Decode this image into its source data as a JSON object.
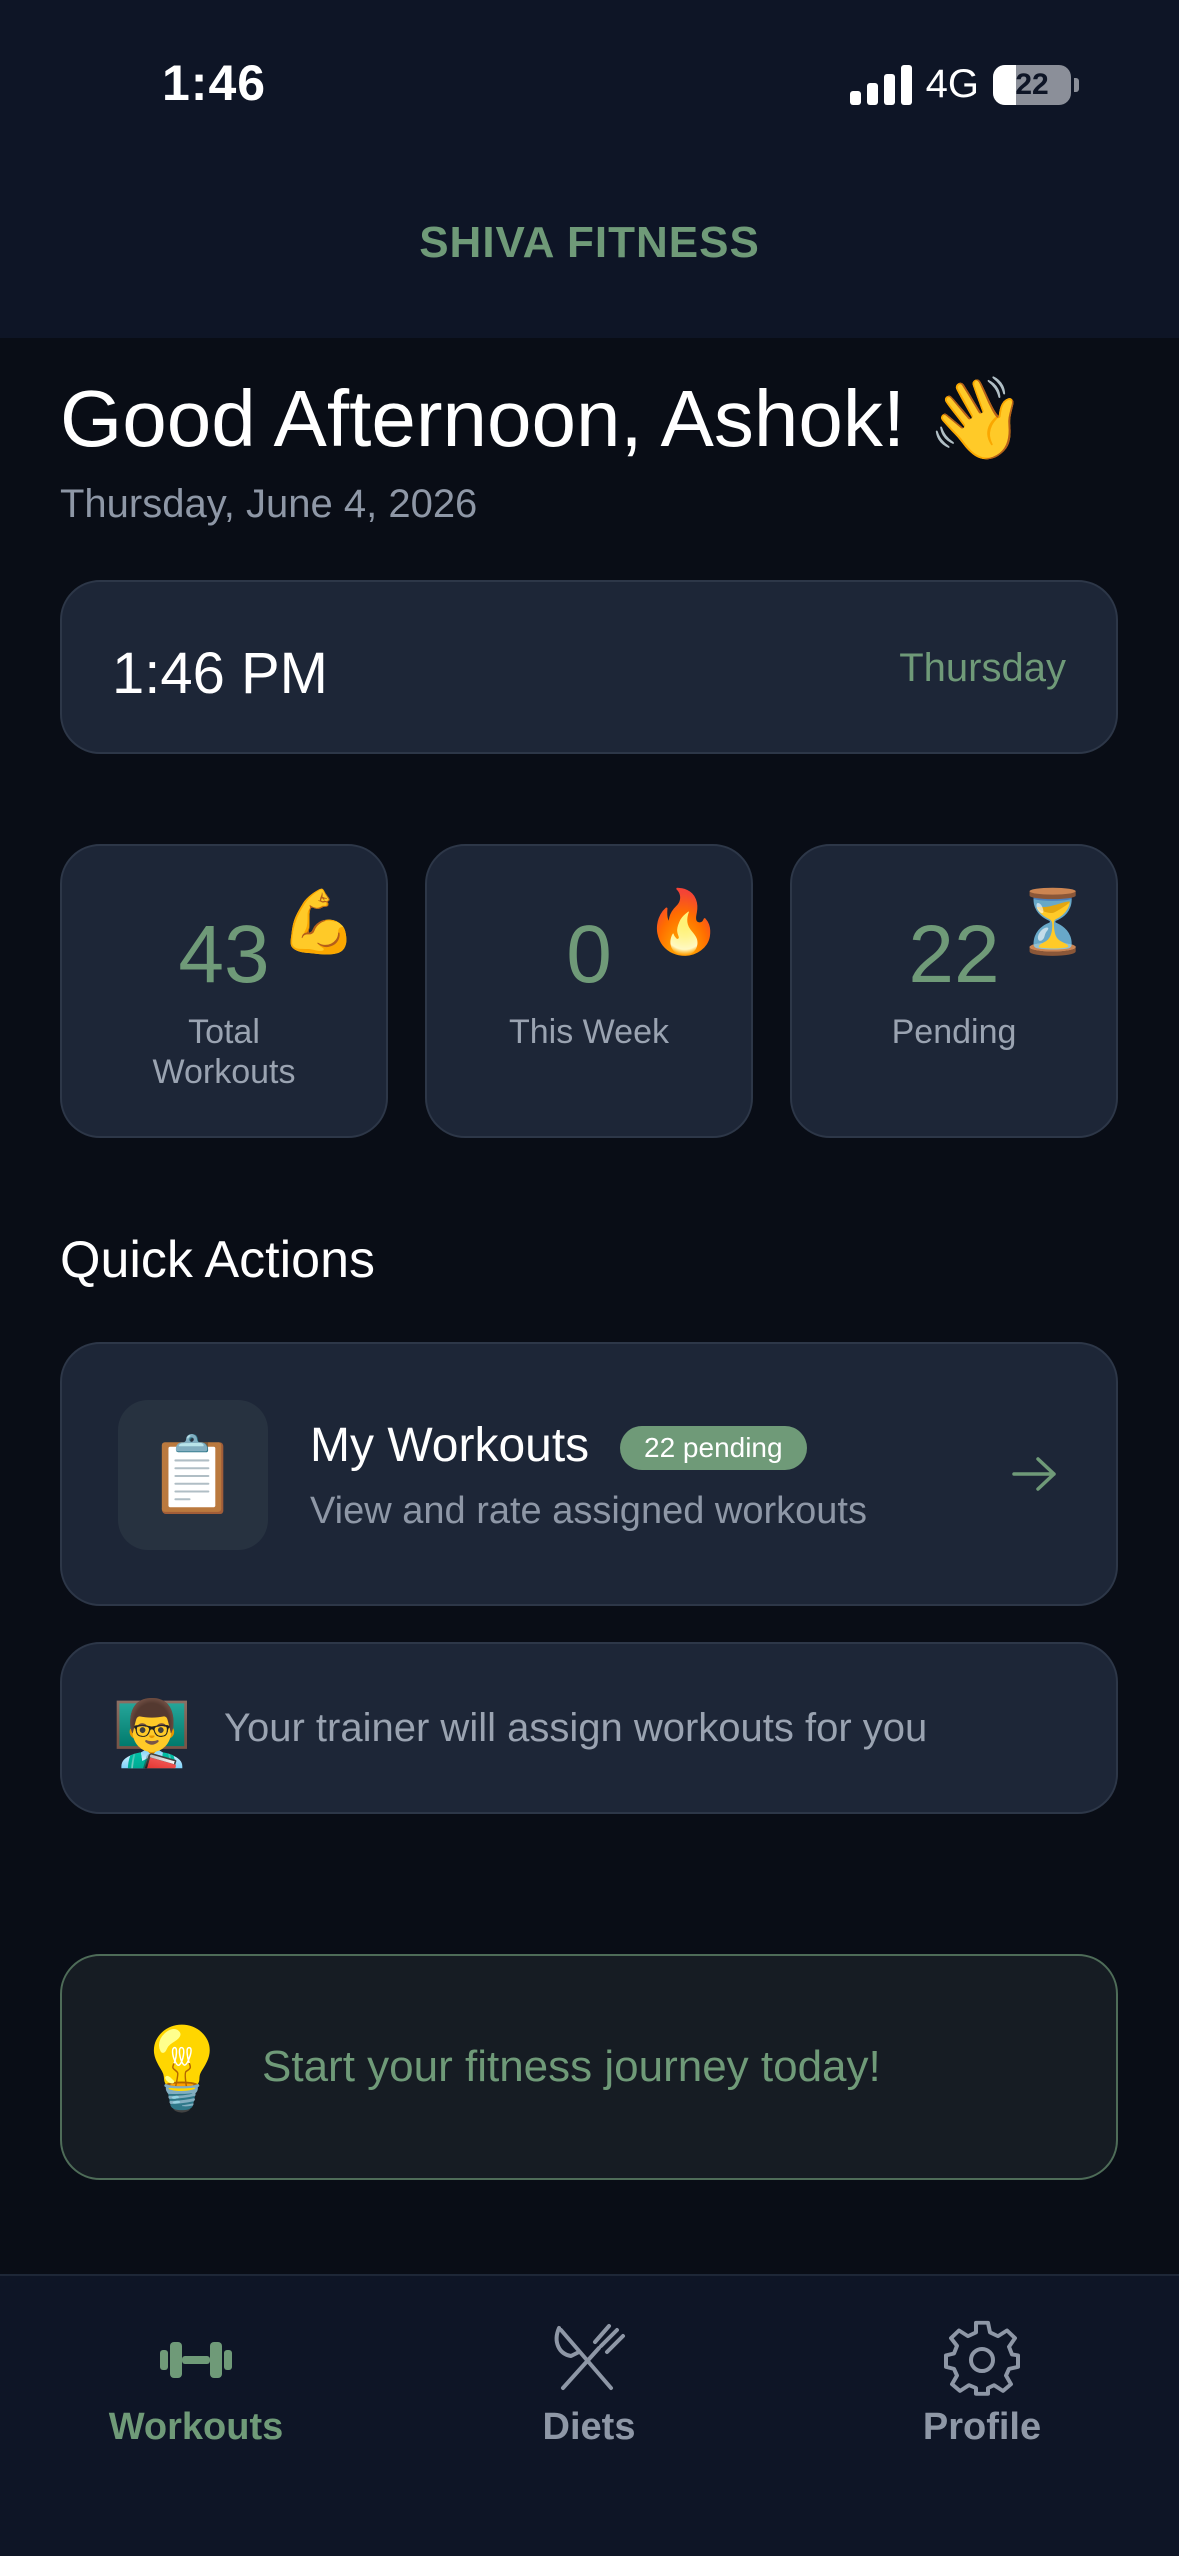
{
  "status_bar": {
    "time": "1:46",
    "network": "4G",
    "battery": "22"
  },
  "header": {
    "title": "SHIVA FITNESS"
  },
  "greeting": {
    "text": "Good Afternoon, Ashok!",
    "emoji": "👋",
    "date": "Thursday, June 4, 2026"
  },
  "clock_card": {
    "time": "1:46 PM",
    "day": "Thursday"
  },
  "stats": [
    {
      "value": "43",
      "emoji": "💪",
      "label_line1": "Total",
      "label_line2": "Workouts"
    },
    {
      "value": "0",
      "emoji": "🔥",
      "label_line1": "This Week",
      "label_line2": ""
    },
    {
      "value": "22",
      "emoji": "⏳",
      "label_line1": "Pending",
      "label_line2": ""
    }
  ],
  "quick_actions": {
    "title": "Quick Actions",
    "my_workouts": {
      "icon": "📋",
      "title": "My Workouts",
      "badge": "22 pending",
      "subtitle": "View and rate assigned workouts"
    },
    "trainer_note": {
      "icon": "👨‍🏫",
      "text": "Your trainer will assign workouts for you"
    }
  },
  "tip": {
    "icon": "💡",
    "text": "Start your fitness journey today!"
  },
  "bottom_nav": [
    {
      "label": "Workouts",
      "icon": "dumbbell-icon"
    },
    {
      "label": "Diets",
      "icon": "utensils-icon"
    },
    {
      "label": "Profile",
      "icon": "gear-icon"
    }
  ],
  "colors": {
    "accent": "#6f9a78",
    "background": "#090d16",
    "card": "#1d2637",
    "muted_text": "#8e97a6"
  }
}
